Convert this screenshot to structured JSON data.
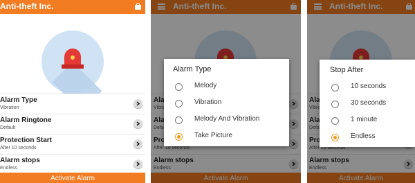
{
  "app": {
    "title": "Anti-theft Inc."
  },
  "settings": [
    {
      "title": "Alarm Type",
      "value": "Vibration"
    },
    {
      "title": "Alarm Ringtone",
      "value": "Default"
    },
    {
      "title": "Protection Start",
      "value": "After 10 seconds"
    },
    {
      "title": "Alarm stops",
      "value": "Endless"
    }
  ],
  "activate_label": "Activate Alarm",
  "alarm_type_dialog": {
    "title": "Alarm Type",
    "options": [
      "Melody",
      "Vibration",
      "Melody And Vibration",
      "Take Picture"
    ],
    "selected": "Take Picture"
  },
  "stop_after_dialog": {
    "title": "Stop After",
    "options": [
      "10 seconds",
      "30 seconds",
      "1 minute",
      "Endless"
    ],
    "selected": "Endless"
  },
  "colors": {
    "toolbar": "#f27c21",
    "radio_selected": "#ec9a1e",
    "siren_red": "#e53935",
    "illustration_bg": "#cfe3f5"
  },
  "icons": [
    "menu-icon",
    "shopping-bag-icon",
    "siren-icon",
    "chevron-right-icon"
  ]
}
